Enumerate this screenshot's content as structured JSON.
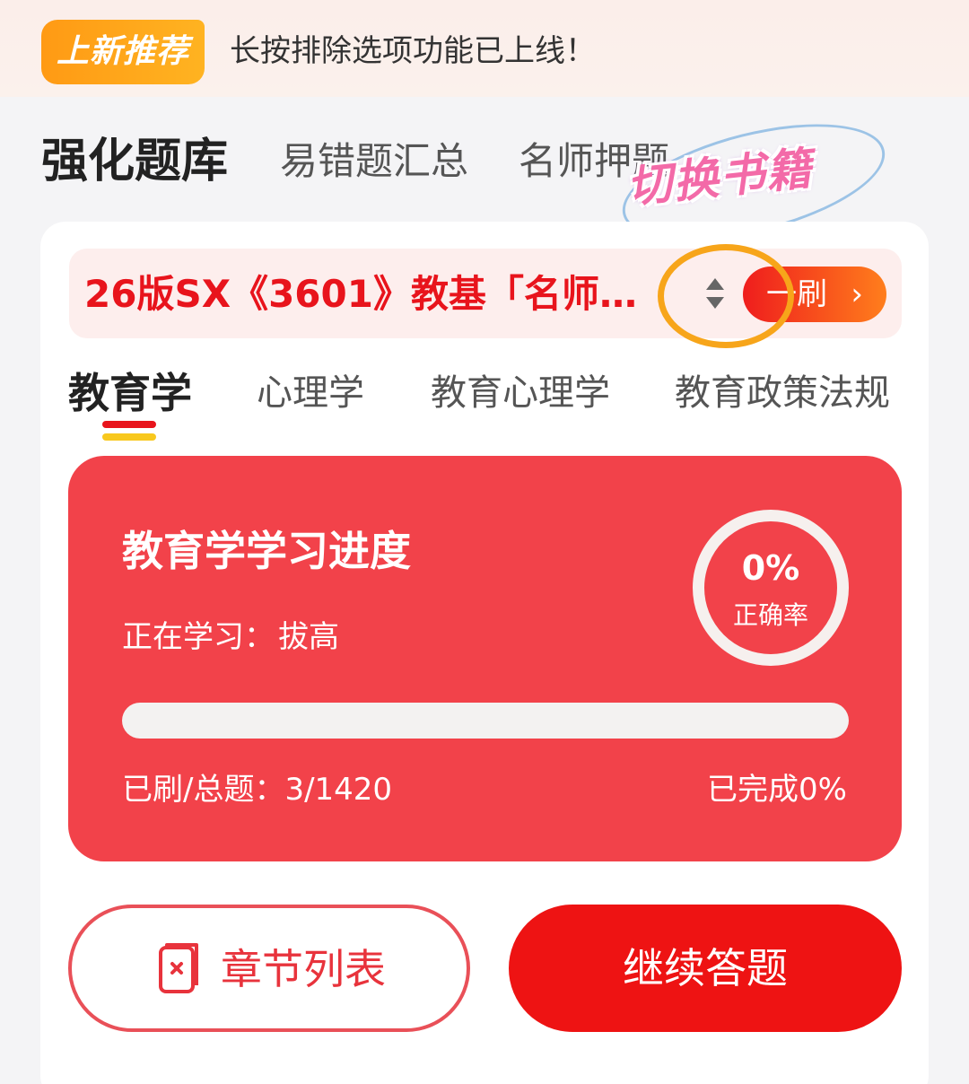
{
  "banner": {
    "badge": "上新推荐",
    "text": "长按排除选项功能已上线！"
  },
  "category_tabs": [
    {
      "label": "强化题库",
      "active": true
    },
    {
      "label": "易错题汇总",
      "active": false
    },
    {
      "label": "名师押题",
      "active": false
    }
  ],
  "sticker": {
    "label": "切换书籍"
  },
  "book": {
    "title": "26版SX《3601》教基「名师…",
    "brush_button": "一刷",
    "sort_icon": "sort-up-down-icon",
    "chevron_icon": "chevron-right-icon"
  },
  "subject_tabs": [
    {
      "label": "教育学",
      "active": true
    },
    {
      "label": "心理学",
      "active": false
    },
    {
      "label": "教育心理学",
      "active": false
    },
    {
      "label": "教育政策法规",
      "active": false
    }
  ],
  "progress": {
    "title": "教育学学习进度",
    "current_label": "正在学习：",
    "current_value": "拔高",
    "accuracy_value": "0%",
    "accuracy_label": "正确率",
    "count_text": "已刷/总题：3/1420",
    "done_text": "已完成0%",
    "completed_fraction": 0
  },
  "actions": {
    "chapter_list": "章节列表",
    "chapter_icon": "document-list-icon",
    "continue": "继续答题"
  },
  "colors": {
    "accent_red": "#ee1313",
    "card_red": "#f2424a",
    "badge_orange": "#ff9a14",
    "highlight_orange": "#f7a51a"
  }
}
